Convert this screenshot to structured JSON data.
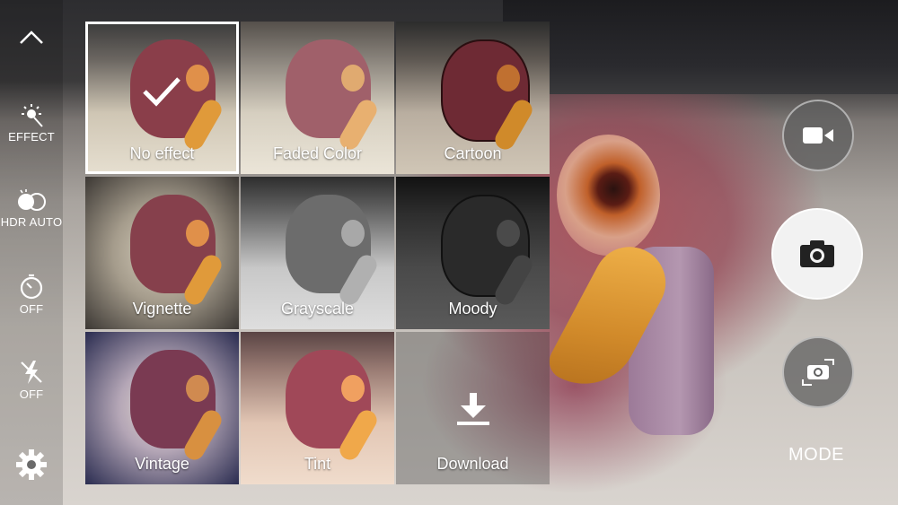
{
  "sidebar": {
    "items": [
      {
        "name": "collapse",
        "label": ""
      },
      {
        "name": "effect",
        "label": "EFFECT"
      },
      {
        "name": "hdr",
        "label": "HDR AUTO"
      },
      {
        "name": "timer",
        "label": "OFF"
      },
      {
        "name": "flash",
        "label": "OFF"
      },
      {
        "name": "settings",
        "label": ""
      }
    ]
  },
  "effects": {
    "tiles": [
      {
        "label": "No effect",
        "selected": true
      },
      {
        "label": "Faded Color",
        "selected": false
      },
      {
        "label": "Cartoon",
        "selected": false
      },
      {
        "label": "Vignette",
        "selected": false
      },
      {
        "label": "Grayscale",
        "selected": false
      },
      {
        "label": "Moody",
        "selected": false
      },
      {
        "label": "Vintage",
        "selected": false
      },
      {
        "label": "Tint",
        "selected": false
      },
      {
        "label": "Download",
        "selected": false
      }
    ]
  },
  "controls": {
    "record_icon": "video-camera-icon",
    "shutter_icon": "camera-icon",
    "switch_icon": "switch-camera-icon",
    "mode_label": "MODE"
  },
  "colors": {
    "selected_border": "#ffffff",
    "shutter_bg": "#f2f2f2",
    "control_bg": "#5f5f5f"
  }
}
